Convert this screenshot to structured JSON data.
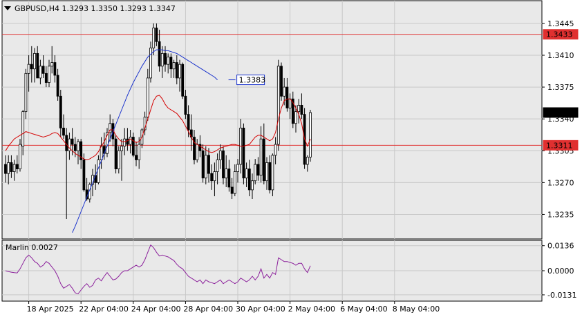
{
  "header": {
    "symbol_line": "GBPUSD,H4  1.3293 1.3350 1.3293 1.3347"
  },
  "indicator": {
    "label": "Marlin 0.0027"
  },
  "colors": {
    "background": "#ffffff",
    "plot_bg": "#e9e9e9",
    "grid": "#c8c8c8",
    "candle_up": "#ffffff",
    "candle_down": "#000000",
    "ma_fast": "#d40000",
    "ma_slow": "#1a33cc",
    "level_line": "#e03030",
    "oscillator": "#8b1f9b",
    "badge_red": "#e03030",
    "badge_price": "#000000",
    "badge_blue": "#1a33cc"
  },
  "chart_data": [
    {
      "type": "candlestick",
      "title": "GBPUSD,H4",
      "ohlc_last": {
        "open": 1.3293,
        "high": 1.335,
        "low": 1.3293,
        "close": 1.3347
      },
      "y_ticks": [
        1.3445,
        1.341,
        1.3375,
        1.334,
        1.3305,
        1.327,
        1.3235
      ],
      "ylim": [
        1.3208,
        1.347
      ],
      "x_tick_labels": [
        "18 Apr 2025",
        "22 Apr 04:00",
        "24 Apr 04:00",
        "28 Apr 04:00",
        "30 Apr 04:00",
        "2 May 04:00",
        "6 May 04:00",
        "8 May 04:00"
      ],
      "x_tick_bars": [
        0,
        18,
        36,
        54,
        72,
        90,
        108,
        126
      ],
      "candles": [
        [
          1.329,
          1.33,
          1.327,
          1.328
        ],
        [
          1.328,
          1.33,
          1.3268,
          1.3292
        ],
        [
          1.3292,
          1.33,
          1.3275,
          1.3282
        ],
        [
          1.3282,
          1.3295,
          1.3272,
          1.329
        ],
        [
          1.329,
          1.33,
          1.328,
          1.3285
        ],
        [
          1.3285,
          1.3318,
          1.3282,
          1.3312
        ],
        [
          1.331,
          1.335,
          1.33,
          1.3348
        ],
        [
          1.3348,
          1.3395,
          1.334,
          1.339
        ],
        [
          1.339,
          1.341,
          1.337,
          1.34
        ],
        [
          1.34,
          1.342,
          1.338,
          1.3395
        ],
        [
          1.3395,
          1.3418,
          1.338,
          1.3412
        ],
        [
          1.3412,
          1.342,
          1.3385,
          1.3385
        ],
        [
          1.3385,
          1.3405,
          1.3378,
          1.3398
        ],
        [
          1.3398,
          1.341,
          1.3385,
          1.339
        ],
        [
          1.339,
          1.3398,
          1.3375,
          1.338
        ],
        [
          1.338,
          1.3405,
          1.3375,
          1.3398
        ],
        [
          1.3398,
          1.342,
          1.339,
          1.3402
        ],
        [
          1.3402,
          1.341,
          1.338,
          1.3388
        ],
        [
          1.3388,
          1.3395,
          1.336,
          1.3365
        ],
        [
          1.3365,
          1.3372,
          1.332,
          1.333
        ],
        [
          1.333,
          1.3345,
          1.3318,
          1.3322
        ],
        [
          1.3322,
          1.333,
          1.323,
          1.3305
        ],
        [
          1.3305,
          1.3325,
          1.3295,
          1.3318
        ],
        [
          1.3318,
          1.333,
          1.33,
          1.3312
        ],
        [
          1.3312,
          1.332,
          1.3298,
          1.3305
        ],
        [
          1.3305,
          1.3318,
          1.329,
          1.3315
        ],
        [
          1.3315,
          1.3318,
          1.3285,
          1.3295
        ],
        [
          1.3295,
          1.3302,
          1.326,
          1.3262
        ],
        [
          1.3262,
          1.3275,
          1.325,
          1.3252
        ],
        [
          1.3252,
          1.327,
          1.3248,
          1.3268
        ],
        [
          1.3268,
          1.3285,
          1.3255,
          1.3278
        ],
        [
          1.3278,
          1.329,
          1.3262,
          1.327
        ],
        [
          1.327,
          1.33,
          1.3268,
          1.3295
        ],
        [
          1.3295,
          1.332,
          1.3285,
          1.331
        ],
        [
          1.331,
          1.3325,
          1.3295,
          1.3302
        ],
        [
          1.3302,
          1.333,
          1.3298,
          1.3325
        ],
        [
          1.3325,
          1.3345,
          1.3315,
          1.3335
        ],
        [
          1.3335,
          1.334,
          1.331,
          1.3318
        ],
        [
          1.3318,
          1.3322,
          1.328,
          1.3285
        ],
        [
          1.3285,
          1.331,
          1.328,
          1.3305
        ],
        [
          1.3305,
          1.3318,
          1.3272,
          1.331
        ],
        [
          1.331,
          1.333,
          1.33,
          1.3318
        ],
        [
          1.3318,
          1.333,
          1.3305,
          1.3312
        ],
        [
          1.3312,
          1.3328,
          1.3302,
          1.332
        ],
        [
          1.332,
          1.3325,
          1.3298,
          1.33
        ],
        [
          1.33,
          1.3315,
          1.3288,
          1.3295
        ],
        [
          1.3295,
          1.332,
          1.3285,
          1.3312
        ],
        [
          1.3312,
          1.333,
          1.3308,
          1.3328
        ],
        [
          1.3328,
          1.3348,
          1.3322,
          1.3342
        ],
        [
          1.3342,
          1.3395,
          1.3338,
          1.3385
        ],
        [
          1.3385,
          1.3425,
          1.338,
          1.3418
        ],
        [
          1.3418,
          1.3445,
          1.341,
          1.344
        ],
        [
          1.344,
          1.3445,
          1.342,
          1.3425
        ],
        [
          1.3425,
          1.3438,
          1.3392,
          1.3398
        ],
        [
          1.3398,
          1.342,
          1.3385,
          1.3412
        ],
        [
          1.3412,
          1.342,
          1.3392,
          1.34
        ],
        [
          1.34,
          1.3412,
          1.339,
          1.3408
        ],
        [
          1.3408,
          1.3412,
          1.3385,
          1.3395
        ],
        [
          1.3395,
          1.3405,
          1.3385,
          1.3402
        ],
        [
          1.3402,
          1.341,
          1.3378,
          1.3385
        ],
        [
          1.3385,
          1.3405,
          1.337,
          1.34
        ],
        [
          1.34,
          1.3402,
          1.3362,
          1.3365
        ],
        [
          1.3365,
          1.3372,
          1.334,
          1.3345
        ],
        [
          1.3345,
          1.3355,
          1.332,
          1.3328
        ],
        [
          1.3328,
          1.3345,
          1.3305,
          1.332
        ],
        [
          1.332,
          1.3328,
          1.329,
          1.3295
        ],
        [
          1.3295,
          1.3318,
          1.3292,
          1.3312
        ],
        [
          1.3312,
          1.3322,
          1.3298,
          1.3305
        ],
        [
          1.3305,
          1.3312,
          1.327,
          1.3275
        ],
        [
          1.3275,
          1.331,
          1.3268,
          1.33
        ],
        [
          1.33,
          1.3308,
          1.327,
          1.328
        ],
        [
          1.328,
          1.329,
          1.3262,
          1.3272
        ],
        [
          1.3272,
          1.3292,
          1.3255,
          1.3282
        ],
        [
          1.3282,
          1.3302,
          1.3268,
          1.3295
        ],
        [
          1.3295,
          1.3312,
          1.3285,
          1.3305
        ],
        [
          1.3305,
          1.331,
          1.3268,
          1.3275
        ],
        [
          1.3275,
          1.33,
          1.3265,
          1.3285
        ],
        [
          1.3285,
          1.3295,
          1.326,
          1.3265
        ],
        [
          1.3265,
          1.3275,
          1.3252,
          1.3258
        ],
        [
          1.3258,
          1.329,
          1.3255,
          1.3282
        ],
        [
          1.3282,
          1.3296,
          1.327,
          1.329
        ],
        [
          1.329,
          1.334,
          1.328,
          1.333
        ],
        [
          1.333,
          1.3335,
          1.3268,
          1.3275
        ],
        [
          1.3275,
          1.3292,
          1.3265,
          1.3285
        ],
        [
          1.3285,
          1.3295,
          1.3255,
          1.3262
        ],
        [
          1.3262,
          1.328,
          1.3252,
          1.3272
        ],
        [
          1.3272,
          1.3296,
          1.3268,
          1.329
        ],
        [
          1.329,
          1.3298,
          1.3272,
          1.3278
        ],
        [
          1.3278,
          1.3332,
          1.327,
          1.3318
        ],
        [
          1.3318,
          1.3335,
          1.3268,
          1.3272
        ],
        [
          1.3272,
          1.3298,
          1.3262,
          1.3292
        ],
        [
          1.3292,
          1.33,
          1.3258,
          1.3262
        ],
        [
          1.3262,
          1.3302,
          1.3255,
          1.33
        ],
        [
          1.33,
          1.332,
          1.329,
          1.3312
        ],
        [
          1.3312,
          1.3405,
          1.3305,
          1.3398
        ],
        [
          1.3398,
          1.3402,
          1.336,
          1.3365
        ],
        [
          1.3365,
          1.3385,
          1.3355,
          1.3375
        ],
        [
          1.3375,
          1.3385,
          1.3348,
          1.3352
        ],
        [
          1.3352,
          1.3368,
          1.334,
          1.3362
        ],
        [
          1.3362,
          1.337,
          1.333,
          1.3335
        ],
        [
          1.3335,
          1.3355,
          1.3325,
          1.3348
        ],
        [
          1.3348,
          1.3362,
          1.3335,
          1.3355
        ],
        [
          1.3355,
          1.3368,
          1.334,
          1.3345
        ],
        [
          1.3345,
          1.3352,
          1.3285,
          1.329
        ],
        [
          1.329,
          1.33,
          1.3282,
          1.3298
        ],
        [
          1.3298,
          1.335,
          1.3293,
          1.3347
        ]
      ],
      "x_offset_bars": -8,
      "series": [
        {
          "name": "",
          "kind": "ma_fast",
          "values": [
            1.3305,
            1.331,
            1.3314,
            1.3318,
            1.332,
            1.3322,
            1.3324,
            1.3326,
            1.3325,
            1.3324,
            1.3323,
            1.3322,
            1.3321,
            1.332,
            1.3321,
            1.3322,
            1.3324,
            1.3325,
            1.3324,
            1.332,
            1.3316,
            1.3312,
            1.3308,
            1.3305,
            1.3302,
            1.33,
            1.3298,
            1.3296,
            1.3295,
            1.3296,
            1.3298,
            1.33,
            1.3304,
            1.331,
            1.3315,
            1.3322,
            1.3328,
            1.3328,
            1.3322,
            1.3318,
            1.3315,
            1.3315,
            1.3316,
            1.3318,
            1.3316,
            1.3314,
            1.3315,
            1.332,
            1.333,
            1.334,
            1.335,
            1.336,
            1.3365,
            1.3366,
            1.3362,
            1.3356,
            1.3352,
            1.335,
            1.3348,
            1.3346,
            1.3342,
            1.3338,
            1.3332,
            1.3326,
            1.332,
            1.3314,
            1.3312,
            1.331,
            1.3308,
            1.3306,
            1.3304,
            1.3303,
            1.3304,
            1.3306,
            1.3308,
            1.3309,
            1.331,
            1.3311,
            1.3312,
            1.3312,
            1.3311,
            1.331,
            1.331,
            1.3311,
            1.3312,
            1.3316,
            1.332,
            1.3322,
            1.3322,
            1.332,
            1.3318,
            1.3316,
            1.3318,
            1.3325,
            1.334,
            1.3352,
            1.336,
            1.3362,
            1.3362,
            1.3358,
            1.3352,
            1.3345,
            1.3335,
            1.3318,
            1.331,
            1.3318
          ]
        },
        {
          "name": "",
          "kind": "ma_slow",
          "values": [
            1.3215,
            1.3222,
            1.323,
            1.3238,
            1.3246,
            1.3254,
            1.3262,
            1.327,
            1.3278,
            1.3286,
            1.3294,
            1.3302,
            1.331,
            1.3318,
            1.3326,
            1.3334,
            1.3342,
            1.335,
            1.3358,
            1.3366,
            1.3373,
            1.338,
            1.3386,
            1.3392,
            1.3398,
            1.3403,
            1.3408,
            1.3411,
            1.3414,
            1.3416,
            1.3416,
            1.3416,
            1.3415,
            1.3415,
            1.3414,
            1.3413,
            1.3412,
            1.341,
            1.3408,
            1.3406,
            1.3404,
            1.3402,
            1.34,
            1.3398,
            1.3396,
            1.3394,
            1.3392,
            1.339,
            1.3388,
            1.3386,
            1.3383
          ]
        }
      ],
      "ma_slow_start_bar": 23,
      "horizontal_levels": [
        {
          "value": 1.3433,
          "label": "1.3433"
        },
        {
          "value": 1.3311,
          "label": "1.3311"
        }
      ],
      "price_badge": {
        "value": 1.3347,
        "label": "1.3347"
      },
      "ma_slow_label": {
        "value": 1.3383,
        "label": "1.3383"
      }
    },
    {
      "type": "line",
      "title": "Marlin 0.0027",
      "y_ticks": [
        0.0136,
        0.0,
        -0.0131
      ],
      "ylim": [
        -0.0165,
        0.0165
      ],
      "values": [
        0.0,
        -0.0005,
        -0.0008,
        -0.001,
        -0.0012,
        0.001,
        0.004,
        0.007,
        0.0085,
        0.007,
        0.005,
        0.004,
        0.002,
        0.003,
        0.005,
        0.004,
        0.002,
        0.0,
        -0.003,
        -0.007,
        -0.0095,
        -0.0085,
        -0.0075,
        -0.0095,
        -0.012,
        -0.0125,
        -0.0105,
        -0.0085,
        -0.007,
        -0.009,
        -0.008,
        -0.005,
        -0.004,
        -0.0055,
        -0.003,
        -0.001,
        -0.003,
        -0.005,
        -0.0045,
        -0.003,
        -0.001,
        0.0,
        0.0,
        0.001,
        0.002,
        0.003,
        0.002,
        0.003,
        0.006,
        0.01,
        0.014,
        0.0125,
        0.01,
        0.008,
        0.0085,
        0.008,
        0.0075,
        0.0065,
        0.0055,
        0.0035,
        0.002,
        0.001,
        -0.001,
        -0.003,
        -0.004,
        -0.005,
        -0.006,
        -0.005,
        -0.007,
        -0.005,
        -0.006,
        -0.0065,
        -0.007,
        -0.006,
        -0.005,
        -0.007,
        -0.006,
        -0.005,
        -0.006,
        -0.007,
        -0.006,
        -0.004,
        -0.005,
        -0.006,
        -0.005,
        -0.003,
        -0.005,
        -0.003,
        0.001,
        -0.004,
        -0.002,
        -0.004,
        -0.001,
        -0.002,
        0.007,
        0.006,
        0.005,
        0.005,
        0.0045,
        0.004,
        0.003,
        0.004,
        0.004,
        0.001,
        -0.001,
        0.0027
      ]
    }
  ]
}
